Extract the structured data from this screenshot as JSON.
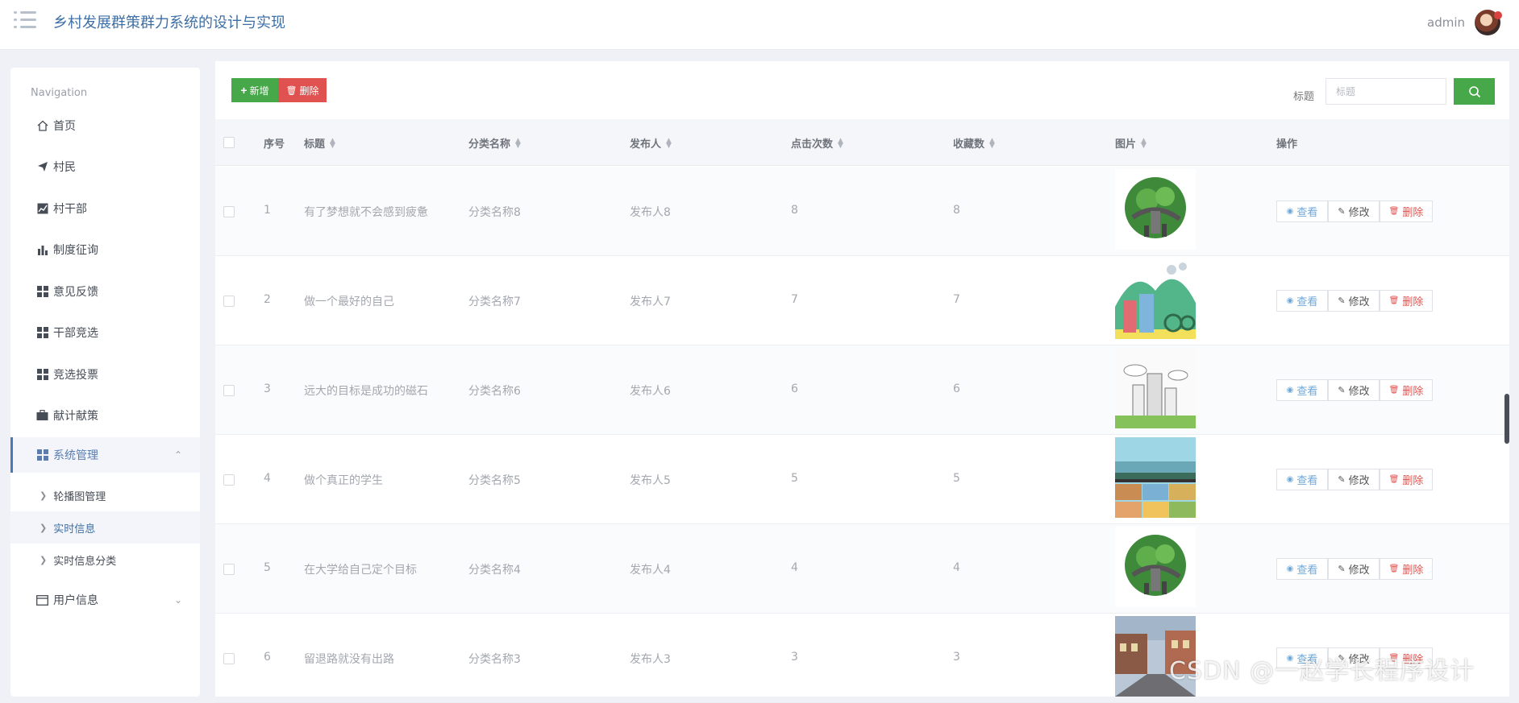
{
  "header": {
    "app_title": "乡村发展群策群力系统的设计与实现",
    "username": "admin"
  },
  "sidebar": {
    "nav_title": "Navigation",
    "items": [
      {
        "label": "首页",
        "icon": "home-icon"
      },
      {
        "label": "村民",
        "icon": "paper-plane-icon"
      },
      {
        "label": "村干部",
        "icon": "line-chart-icon"
      },
      {
        "label": "制度征询",
        "icon": "bar-chart-icon"
      },
      {
        "label": "意见反馈",
        "icon": "grid-icon"
      },
      {
        "label": "干部竞选",
        "icon": "grid-icon"
      },
      {
        "label": "竞选投票",
        "icon": "grid-icon"
      },
      {
        "label": "献计献策",
        "icon": "briefcase-icon"
      },
      {
        "label": "系统管理",
        "icon": "grid-icon",
        "expanded": true
      },
      {
        "label": "用户信息",
        "icon": "card-icon",
        "expanded": false
      }
    ],
    "sub_items": [
      {
        "label": "轮播图管理"
      },
      {
        "label": "实时信息",
        "active": true
      },
      {
        "label": "实时信息分类"
      }
    ]
  },
  "toolbar": {
    "add_label": "新增",
    "delete_label": "删除",
    "search_label": "标题",
    "search_placeholder": "标题"
  },
  "table": {
    "columns": [
      "序号",
      "标题",
      "分类名称",
      "发布人",
      "点击次数",
      "收藏数",
      "图片",
      "操作"
    ],
    "rows": [
      {
        "index": "1",
        "title": "有了梦想就不会感到疲惫",
        "category": "分类名称8",
        "publisher": "发布人8",
        "clicks": "8",
        "favorites": "8",
        "image": "green-globe"
      },
      {
        "index": "2",
        "title": "做一个最好的自己",
        "category": "分类名称7",
        "publisher": "发布人7",
        "clicks": "7",
        "favorites": "7",
        "image": "city-bicycle"
      },
      {
        "index": "3",
        "title": "远大的目标是成功的磁石",
        "category": "分类名称6",
        "publisher": "发布人6",
        "clicks": "6",
        "favorites": "6",
        "image": "city-sketch"
      },
      {
        "index": "4",
        "title": "做个真正的学生",
        "category": "分类名称5",
        "publisher": "发布人5",
        "clicks": "5",
        "favorites": "5",
        "image": "street-scene"
      },
      {
        "index": "5",
        "title": "在大学给自己定个目标",
        "category": "分类名称4",
        "publisher": "发布人4",
        "clicks": "4",
        "favorites": "4",
        "image": "green-globe"
      },
      {
        "index": "6",
        "title": "留退路就没有出路",
        "category": "分类名称3",
        "publisher": "发布人3",
        "clicks": "3",
        "favorites": "3",
        "image": "town-street"
      }
    ],
    "actions": {
      "view": "查看",
      "edit": "修改",
      "delete": "删除"
    }
  },
  "watermark": "CSDN @一赵学长程序设计",
  "colors": {
    "primary": "#3d6fa6",
    "add_green": "#46a849",
    "danger_red": "#e0524f",
    "view_blue": "#6fa8d8"
  }
}
